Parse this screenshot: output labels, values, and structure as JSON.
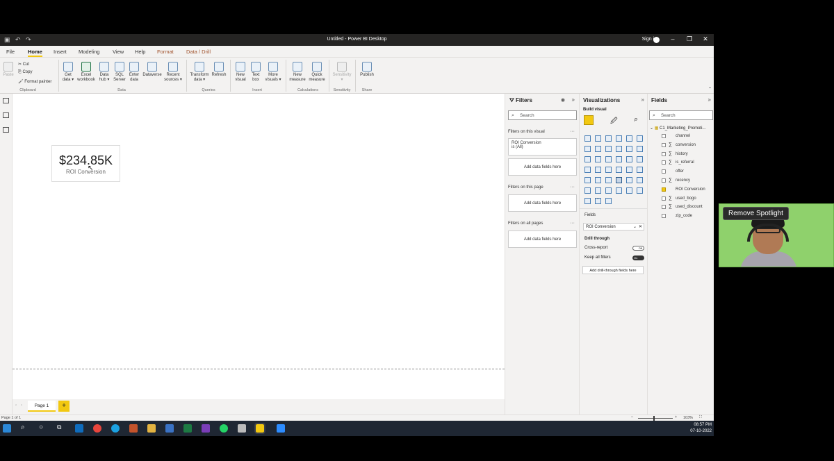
{
  "window": {
    "title": "Untitled - Power BI Desktop",
    "sign_in": "Sign in"
  },
  "menu": {
    "tabs": [
      "File",
      "Home",
      "Insert",
      "Modeling",
      "View",
      "Help",
      "Format",
      "Data / Drill"
    ]
  },
  "ribbon": {
    "clipboard": {
      "paste": "Paste",
      "cut": "Cut",
      "copy": "Copy",
      "format_painter": "Format painter",
      "group": "Clipboard"
    },
    "data": {
      "items": [
        [
          "Get",
          "data ▾"
        ],
        [
          "Excel",
          "workbook"
        ],
        [
          "Data",
          "hub ▾"
        ],
        [
          "SQL",
          "Server"
        ],
        [
          "Enter",
          "data"
        ],
        [
          "Dataverse",
          ""
        ],
        [
          "Recent",
          "sources ▾"
        ]
      ],
      "group": "Data"
    },
    "queries": {
      "items": [
        [
          "Transform",
          "data ▾"
        ],
        [
          "Refresh",
          ""
        ]
      ],
      "group": "Queries"
    },
    "insert": {
      "items": [
        [
          "New",
          "visual"
        ],
        [
          "Text",
          "box"
        ],
        [
          "More",
          "visuals ▾"
        ]
      ],
      "group": "Insert"
    },
    "calculations": {
      "items": [
        [
          "New",
          "measure"
        ],
        [
          "Quick",
          "measure"
        ]
      ],
      "group": "Calculations"
    },
    "sensitivity": {
      "items": [
        [
          "Sensitivity",
          "▾"
        ]
      ],
      "group": "Sensitivity"
    },
    "share": {
      "items": [
        [
          "Publish",
          ""
        ]
      ],
      "group": "Share"
    }
  },
  "card": {
    "value": "$234.85K",
    "label": "ROI Conversion"
  },
  "pages": {
    "tab": "Page 1",
    "add": "+"
  },
  "status": {
    "page": "Page 1 of 1",
    "zoom": "103%"
  },
  "filters": {
    "title": "Filters",
    "search": "Search",
    "on_visual": "Filters on this visual",
    "filter_card_title": "ROI Conversion",
    "filter_card_value": "is (All)",
    "add_fields": "Add data fields here",
    "on_page": "Filters on this page",
    "on_all": "Filters on all pages"
  },
  "visualizations": {
    "title": "Visualizations",
    "build": "Build visual",
    "fields_label": "Fields",
    "field_well": "ROI Conversion",
    "drill_through": "Drill through",
    "cross_report": "Cross-report",
    "cross_report_state": "Off",
    "keep_filters": "Keep all filters",
    "keep_filters_state": "On",
    "add_drill": "Add drill-through fields here",
    "more": "···"
  },
  "fields": {
    "title": "Fields",
    "search": "Search",
    "table": "C1_Marketing_Promoti...",
    "items": [
      {
        "name": "channel",
        "sigma": false,
        "checked": false
      },
      {
        "name": "conversion",
        "sigma": true,
        "checked": false
      },
      {
        "name": "history",
        "sigma": true,
        "checked": false
      },
      {
        "name": "is_referral",
        "sigma": true,
        "checked": false
      },
      {
        "name": "offer",
        "sigma": false,
        "checked": false
      },
      {
        "name": "recency",
        "sigma": true,
        "checked": false
      },
      {
        "name": "ROI Conversion",
        "sigma": false,
        "checked": true
      },
      {
        "name": "used_bogo",
        "sigma": true,
        "checked": false
      },
      {
        "name": "used_discount",
        "sigma": true,
        "checked": false
      },
      {
        "name": "zip_code",
        "sigma": false,
        "checked": false
      }
    ]
  },
  "spotlight": {
    "button": "Remove Spotlight"
  },
  "taskbar": {
    "time": "08:57 PM",
    "date": "07-10-2022"
  },
  "colors": {
    "accent": "#f2c811",
    "titlebar": "#252423",
    "spotlight_bg": "#8fd16c"
  }
}
